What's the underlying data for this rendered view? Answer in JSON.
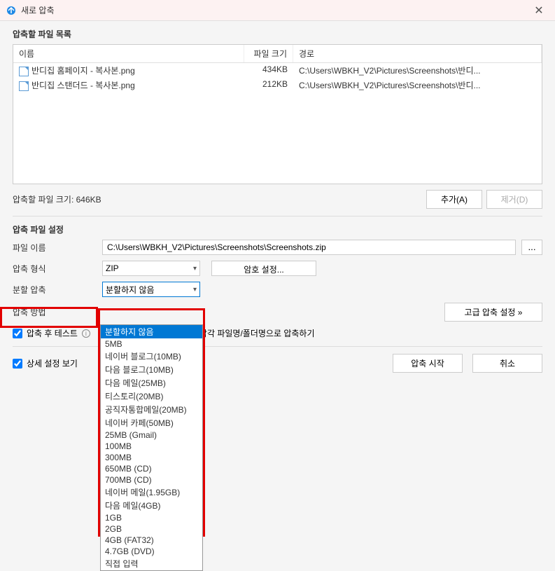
{
  "titlebar": {
    "title": "새로 압축"
  },
  "file_list": {
    "label": "압축할 파일 목록",
    "columns": {
      "name": "이름",
      "size": "파일 크기",
      "path": "경로"
    },
    "rows": [
      {
        "name": "반디집 홈페이지 - 복사본.png",
        "size": "434KB",
        "path": "C:\\Users\\WBKH_V2\\Pictures\\Screenshots\\반디..."
      },
      {
        "name": "반디집 스탠더드 - 복사본.png",
        "size": "212KB",
        "path": "C:\\Users\\WBKH_V2\\Pictures\\Screenshots\\반디..."
      }
    ],
    "total_label": "압축할 파일 크기: 646KB",
    "add_btn": "추가(A)",
    "remove_btn": "제거(D)"
  },
  "settings": {
    "label": "압축 파일 설정",
    "filename_label": "파일 이름",
    "filename_value": "C:\\Users\\WBKH_V2\\Pictures\\Screenshots\\Screenshots.zip",
    "browse_btn": "...",
    "format_label": "압축 형식",
    "format_value": "ZIP",
    "password_btn": "암호 설정...",
    "split_label": "분할 압축",
    "split_value": "분할하지 않음",
    "split_options": [
      "분할하지 않음",
      "5MB",
      "네이버 블로그(10MB)",
      "다음 블로그(10MB)",
      "다음 메일(25MB)",
      "티스토리(20MB)",
      "공직자통합메일(20MB)",
      "네이버 카페(50MB)",
      "25MB (Gmail)",
      "100MB",
      "300MB",
      "650MB (CD)",
      "700MB (CD)",
      "네이버 메일(1.95GB)",
      "다음 메일(4GB)",
      "1GB",
      "2GB",
      "4GB (FAT32)",
      "4.7GB (DVD)",
      "직접 입력"
    ],
    "method_label": "압축 방법",
    "advanced_btn": "고급 압축 설정 »",
    "test_after_label": "압축 후 테스트",
    "each_file_label": "각각 파일명/폴더명으로 압축하기",
    "detail_label": "상세 설정 보기",
    "start_btn": "압축 시작",
    "cancel_btn": "취소"
  }
}
